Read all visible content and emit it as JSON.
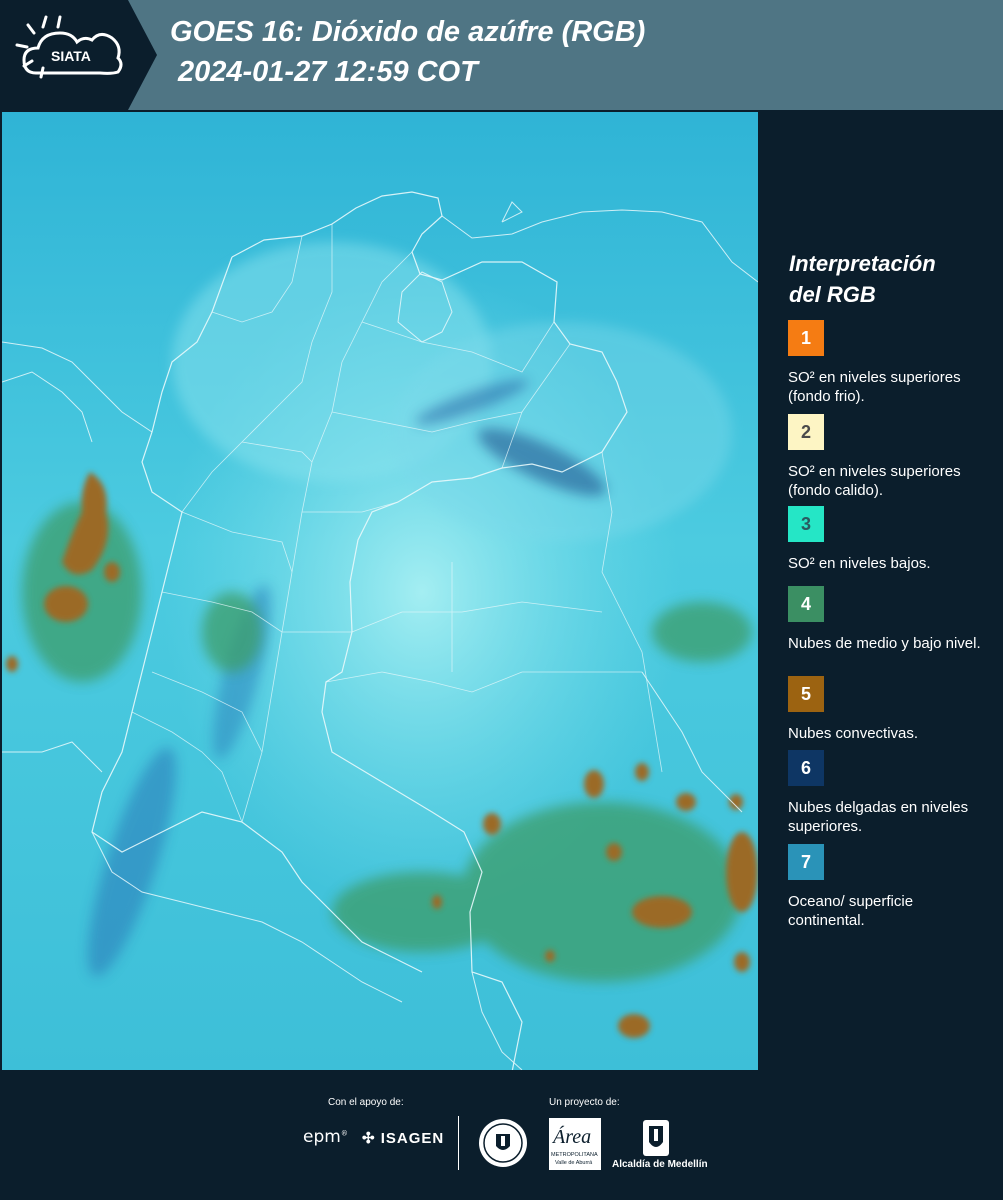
{
  "header": {
    "logo_text": "SIATA",
    "title": "GOES 16: Dióxido de azúfre (RGB)",
    "subtitle": "2024-01-27 12:59 COT"
  },
  "legend": {
    "title_line1": "Interpretación",
    "title_line2": "del RGB",
    "items": [
      {
        "number": "1",
        "text": "SO² en niveles superiores (fondo frio).",
        "color": "#f57c13",
        "text_color": "#ffffff"
      },
      {
        "number": "2",
        "text": "SO² en niveles superiores (fondo calido).",
        "color": "#fdf5c4",
        "text_color": "#4a4a4a"
      },
      {
        "number": "3",
        "text": "SO² en niveles bajos.",
        "color": "#25e6c6",
        "text_color": "#2a5a60"
      },
      {
        "number": "4",
        "text": "Nubes de medio y bajo nivel.",
        "color": "#3b8f63",
        "text_color": "#ffffff"
      },
      {
        "number": "5",
        "text": "Nubes convectivas.",
        "color": "#9c6311",
        "text_color": "#ffffff"
      },
      {
        "number": "6",
        "text": "Nubes delgadas en niveles superiores.",
        "color": "#0e3664",
        "text_color": "#ffffff"
      },
      {
        "number": "7",
        "text": "Oceano/ superficie continental.",
        "color": "#2a93b8",
        "text_color": "#ffffff"
      }
    ]
  },
  "footer": {
    "support_label": "Con el apoyo de:",
    "project_label": "Un proyecto de:",
    "epm": "epm",
    "isagen": "ISAGEN",
    "area_text": "Área",
    "area_sub1": "METROPOLITANA",
    "area_sub2": "Valle de Aburrá",
    "alcaldia": "Alcaldía de Medellín"
  }
}
